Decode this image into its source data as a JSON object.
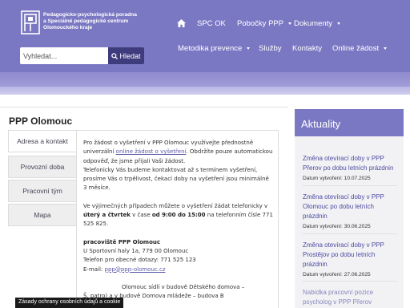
{
  "brand": {
    "logo_lines": [
      "Pedagogicko-psychologická poradna",
      "a Speciálně pedagogické centrum",
      "Olomouckého kraje"
    ]
  },
  "nav": {
    "home_icon": "home-icon",
    "top": [
      {
        "label": "SPC OK",
        "dropdown": false
      },
      {
        "label": "Pobočky PPP",
        "dropdown": true
      },
      {
        "label": "Dokumenty",
        "dropdown": true
      }
    ],
    "bottom": [
      {
        "label": "Metodika prevence",
        "dropdown": true
      },
      {
        "label": "Služby",
        "dropdown": false
      },
      {
        "label": "Kontakty",
        "dropdown": false
      },
      {
        "label": "Online žádost",
        "dropdown": true
      }
    ]
  },
  "search": {
    "placeholder": "Vyhledat...",
    "button_label": "Hledat"
  },
  "page": {
    "title": "PPP Olomouc"
  },
  "tabs": [
    {
      "label": "Adresa a kontakt",
      "active": true
    },
    {
      "label": "Provozní doba",
      "active": false
    },
    {
      "label": "Pracovní tým",
      "active": false
    },
    {
      "label": "Mapa",
      "active": false
    }
  ],
  "content": {
    "p1_a": "Pro žádost o vyšetření v  PPP Olomouc využívejte přednostně univerzální ",
    "p1_link": "online žádost o vyšetření",
    "p1_b": ". Obdržíte pouze automatickou odpověď, že jsme přijali Vaši žádost.",
    "p1_c": "Telefonicky Vás budeme kontaktovat až s termínem vyšetření, prosíme Vás o trpělivost, čekací doby na vyšetření jsou minimálně 3 měsíce.",
    "p2_a": "Ve výjimečných případech můžete o vyšetření žádat telefonicky v ",
    "p2_days": "úterý a čtvrtek",
    "p2_b": " v čase ",
    "p2_time": "od 9:00 do 15:00",
    "p2_c": " na telefonním čísle 771 525 825.",
    "addr_title": "pracoviště PPP Olomouc",
    "addr_line": "U Sportovní haly 1a, 779 00 Olomouc",
    "phone_line": "Telefon pro obecné dotazy: 771 525 123",
    "email_label": "E-mail: ",
    "email": "ppp@ppp-olomouc.cz",
    "p4_a": "Olomouc sídlí v budově Dětského domova –",
    "p4_b": "Š. patro) a v budově Domova mládeže – budova B"
  },
  "sidebar": {
    "heading": "Aktuality",
    "created_label": "Datum vytvoření:",
    "news": [
      {
        "title": "Změna otevírací doby v PPP Přerov po dobu letních prázdnin",
        "date": "10.07.2025"
      },
      {
        "title": "Změna otevírací doby v PPP Olomouc po dobu letních prázdnin",
        "date": "30.06.2025"
      },
      {
        "title": "Změna otevírací doby v PPP Prostějov po dobu letních prázdnin",
        "date": "27.06.2025"
      },
      {
        "title": "Nabídka pracovní pozice psycholog v PPP Přerov",
        "date": ""
      }
    ]
  },
  "cookie": {
    "text": "Zásady ochrany osobních údajů a cookie"
  },
  "colors": {
    "header": "#7b78c3",
    "accent_dark": "#3f3c7e",
    "link": "#5a57a8"
  }
}
